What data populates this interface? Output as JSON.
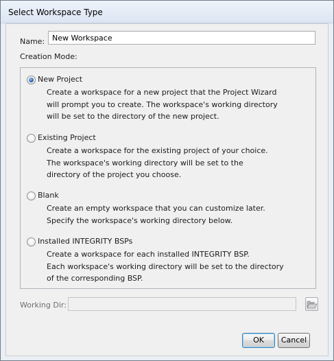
{
  "window": {
    "title": "Select Workspace Type"
  },
  "name_field": {
    "label": "Name:",
    "value": "New Workspace"
  },
  "creation_mode": {
    "label": "Creation Mode:",
    "options": [
      {
        "label": "New Project",
        "checked": true,
        "description": [
          "Create a workspace for a new project that the Project Wizard",
          "will prompt you to create. The workspace's working directory",
          "will be set to the directory of the new project."
        ]
      },
      {
        "label": "Existing Project",
        "checked": false,
        "description": [
          "Create a workspace for the existing project of your choice.",
          "The workspace's working directory will be set to the",
          "directory of the project you choose."
        ]
      },
      {
        "label": "Blank",
        "checked": false,
        "description": [
          "Create an empty workspace that you can customize later.",
          "Specify the workspace's working directory below."
        ]
      },
      {
        "label": "Installed INTEGRITY BSPs",
        "checked": false,
        "description": [
          "Create a workspace for each installed INTEGRITY BSP.",
          "Each workspace's working directory will be set to the directory",
          "of the corresponding BSP."
        ]
      }
    ]
  },
  "working_dir": {
    "label": "Working Dir:",
    "value": "",
    "disabled": true,
    "browse_icon": "folder-open-icon"
  },
  "buttons": {
    "ok": "OK",
    "cancel": "Cancel"
  }
}
